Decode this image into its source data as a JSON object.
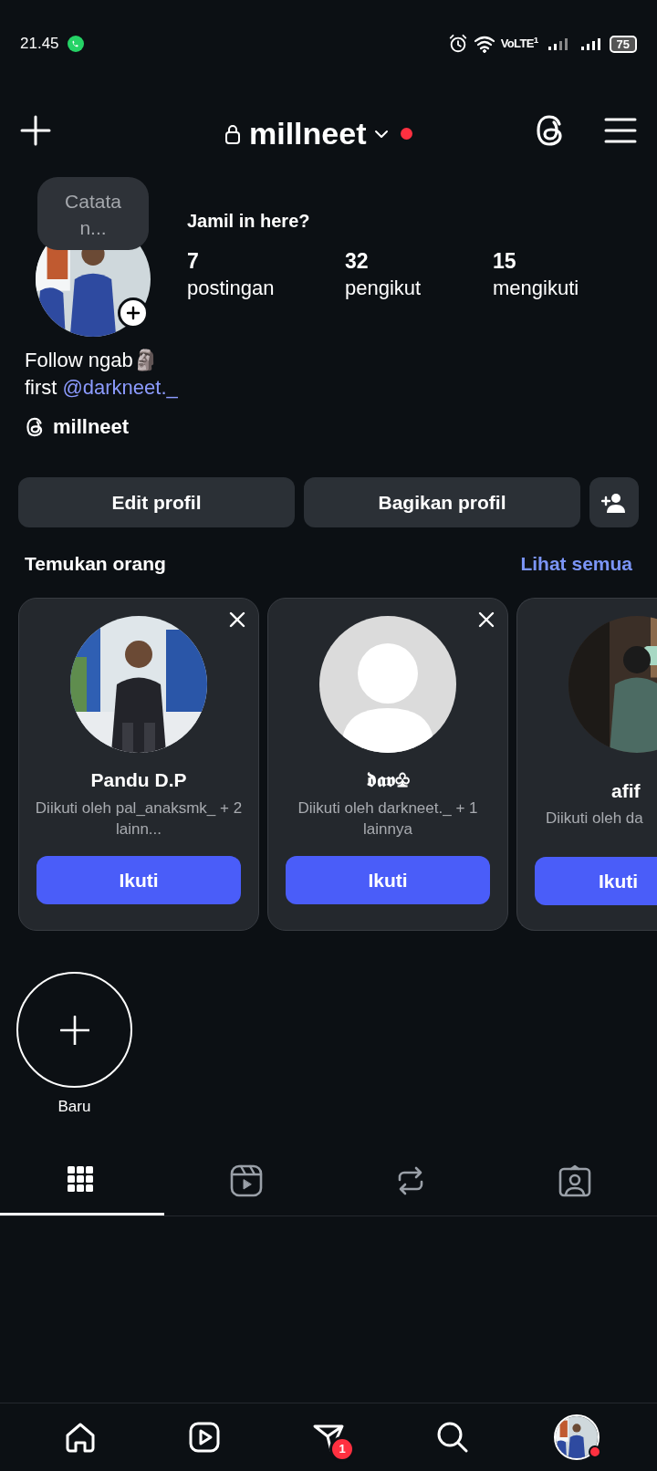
{
  "status_bar": {
    "time": "21.45",
    "network": "VoLTE$^{1}$",
    "battery": "75"
  },
  "header": {
    "username": "millneet",
    "private": true,
    "notification_dot": true
  },
  "profile": {
    "note": "Catatan...",
    "name": "Jamil in here?",
    "stats": [
      {
        "value": "7",
        "label": "postingan"
      },
      {
        "value": "32",
        "label": "pengikut"
      },
      {
        "value": "15",
        "label": "mengikuti"
      }
    ],
    "bio_line": "Follow ngab🗿",
    "bio_prefix": "first",
    "mention": "@darkneet._",
    "threads_handle": "millneet"
  },
  "buttons": [
    "Edit profil",
    "Bagikan profil"
  ],
  "discover": {
    "title": "Temukan orang",
    "see_all": "Lihat semua",
    "cards": [
      {
        "default_avatar": false,
        "name": "Pandu D.P",
        "subtitle": "Diikuti oleh pal_anaksmk_ + 2 lainn...",
        "button": "Ikuti",
        "cut": false
      },
      {
        "default_avatar": true,
        "name": "𝖉𝖆𝖛♧",
        "subtitle": "Diikuti oleh darkneet._ + 1 lainnya",
        "button": "Ikuti",
        "cut": false
      },
      {
        "default_avatar": false,
        "name": "afif",
        "subtitle": "Diikuti oleh da",
        "button": "Ikuti",
        "cut": true
      }
    ]
  },
  "highlights": [
    {
      "label": "Baru"
    }
  ],
  "tabs": [
    {
      "kind": "grid",
      "selected": true
    },
    {
      "kind": "reels",
      "selected": false
    },
    {
      "kind": "reposts",
      "selected": false
    },
    {
      "kind": "tagged",
      "selected": false
    }
  ],
  "bottom_nav": [
    {
      "kind": "home"
    },
    {
      "kind": "reels"
    },
    {
      "kind": "messages",
      "badge": "1"
    },
    {
      "kind": "search"
    },
    {
      "kind": "profile",
      "dot": true
    }
  ]
}
